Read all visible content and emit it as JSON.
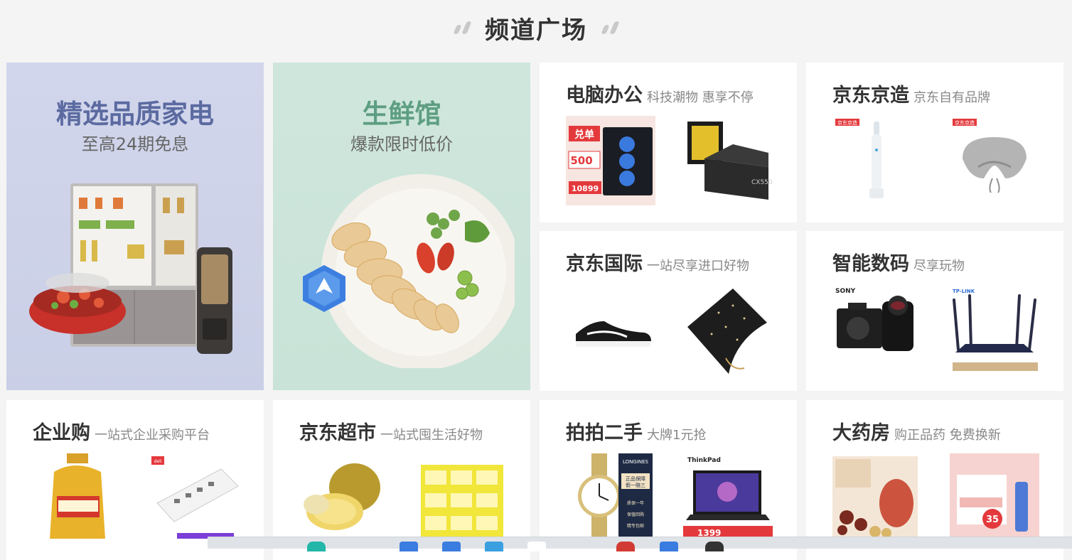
{
  "header": {
    "title": "频道广场"
  },
  "channels": {
    "appliance": {
      "title": "精选品质家电",
      "subtitle": "至高24期免息"
    },
    "fresh": {
      "title": "生鲜馆",
      "subtitle": "爆款限时低价"
    },
    "computer": {
      "name": "电脑办公",
      "slogan": "科技潮物 惠享不停",
      "badge_text": "兑单",
      "badge_price": "500",
      "badge_price2": "10899",
      "psu_label": "CX550"
    },
    "jdmade": {
      "name": "京东京造",
      "slogan": "京东自有品牌",
      "brand_tag": "京东京造"
    },
    "global": {
      "name": "京东国际",
      "slogan": "一站尽享进口好物"
    },
    "digital": {
      "name": "智能数码",
      "slogan": "尽享玩物",
      "camera_brand": "SONY",
      "router_brand": "TP-LINK"
    },
    "enterprise": {
      "name": "企业购",
      "slogan": "一站式企业采购平台",
      "deli_tag": "deli"
    },
    "supermarket": {
      "name": "京东超市",
      "slogan": "一站式囤生活好物"
    },
    "secondhand": {
      "name": "拍拍二手",
      "slogan": "大牌1元抢",
      "watch_brand": "LONGINES",
      "laptop_brand": "ThinkPad",
      "laptop_price": "1399",
      "guarantee": [
        "正品保障",
        "假一赔三",
        "质保一年",
        "保值回购",
        "精专包邮"
      ]
    },
    "pharmacy": {
      "name": "大药房",
      "slogan": "购正品药 免费换新",
      "price_tag": "35"
    }
  },
  "colors": {
    "page_bg": "#f4f4f4",
    "card_bg": "#ffffff",
    "appliance_title": "#5b6aa0",
    "fresh_title": "#5e9e82",
    "accent_red": "#e4393c"
  }
}
